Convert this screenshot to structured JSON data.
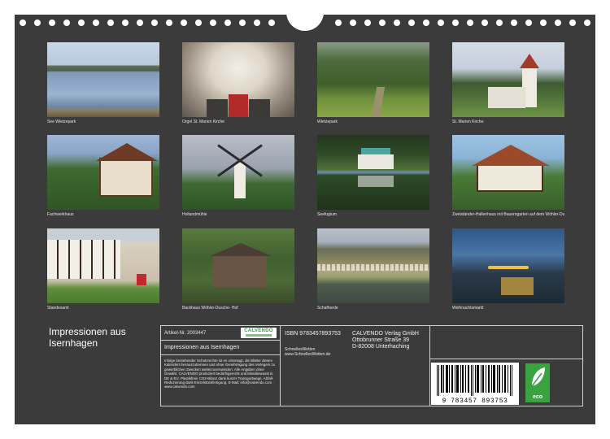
{
  "photos": [
    {
      "caption": "See Wietzepark"
    },
    {
      "caption": "Orgel St. Marien Kirche"
    },
    {
      "caption": "Wietzepark"
    },
    {
      "caption": "St. Marien Kirche"
    },
    {
      "caption": "Fachwerkhaus"
    },
    {
      "caption": "Hollandmühle"
    },
    {
      "caption": "Seefugium"
    },
    {
      "caption": "Zweiständer-Hallenhaus mit Bauerngarten auf dem Wöhler-Dusche-Hof"
    },
    {
      "caption": "Standesamt"
    },
    {
      "caption": "Backhaus Wöhler-Dusche- Hof"
    },
    {
      "caption": "Schafherde"
    },
    {
      "caption": "Weihnachtsmarkt"
    }
  ],
  "title": "Impressionen aus Isernhagen",
  "info": {
    "article_label": "Artikel-Nr. 2003447",
    "logo_text": "CALVENDO",
    "product_title": "Impressionen aus Isernhagen",
    "legal_text": "Infolge bestehender Schutzrechte ist es untersagt, die Blätter dieses Kalenders herauszutrennen und ohne Genehmigung des Verlegers zu gewerblichen Zwecken weiterzuverwenden. Alle Angaben ohne Gewähr. CALVENDO produziert bedarfsgerecht und klimabewusst in DE & EU. Plastikfreie CO2-Bilanz dank kurzer Transportwege. Abfall-Reduzierung dank Einzelstückfertigung. E-Mail: info@calvendo.com · www.calvendo.com",
    "isbn": "ISBN 9783457893753",
    "author_name": "SchnellesWetten",
    "author_url": "www.SchnellesWetten.de",
    "publisher_line1": "CALVENDO Verlag GmbH",
    "publisher_line2": "Ottobrunner Straße 39",
    "publisher_line3": "D-82008 Unterhaching",
    "barcode_number": "9 783457 893753",
    "eco_label": "eco"
  },
  "colors": {
    "background": "#3b3b3b",
    "eco_green": "#3aa23f",
    "brand_green": "#2ea34a"
  }
}
